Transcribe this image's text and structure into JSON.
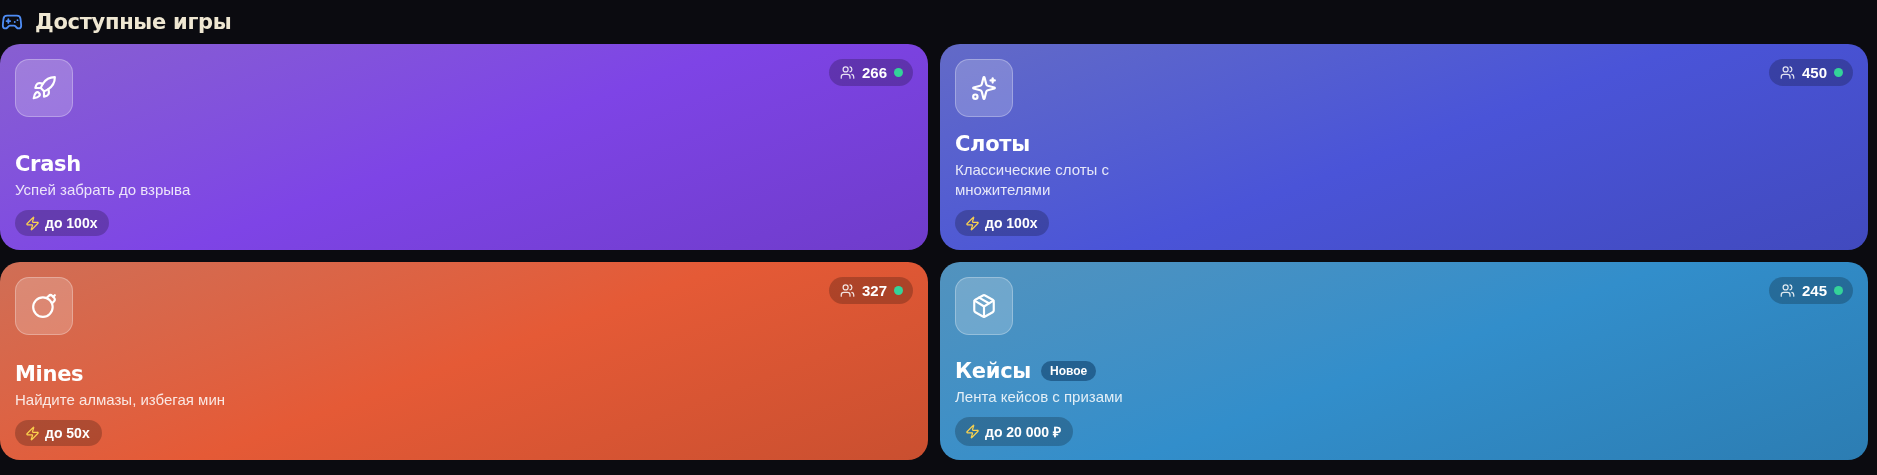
{
  "section": {
    "title": "Доступные игры"
  },
  "games": [
    {
      "title": "Crash",
      "description": "Успей забрать до взрыва",
      "multiplier": "до 100x",
      "players": "266",
      "online": true,
      "color": "#7e44e6"
    },
    {
      "title": "Слоты",
      "description": "Классические слоты с множителями",
      "multiplier": "до 100x",
      "players": "450",
      "online": true,
      "color": "#4a54d8"
    },
    {
      "title": "Mines",
      "description": "Найдите алмазы, избегая мин",
      "multiplier": "до 50x",
      "players": "327",
      "online": true,
      "color": "#e55a36"
    },
    {
      "title": "Кейсы",
      "tag": "Новое",
      "description": "Лента кейсов с призами",
      "multiplier": "до 20 000 ₽",
      "players": "245",
      "online": true,
      "color": "#328ecb"
    }
  ]
}
